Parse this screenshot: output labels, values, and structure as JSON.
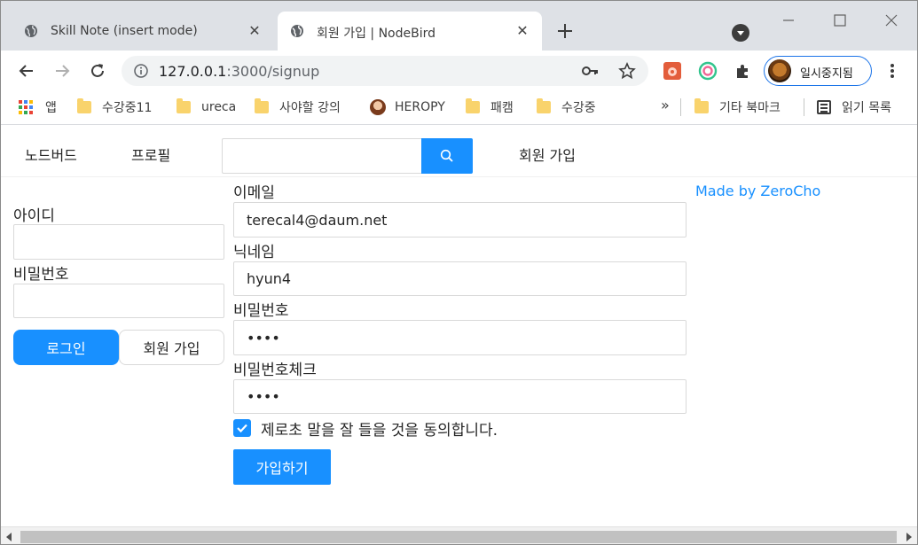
{
  "browser": {
    "tabs": [
      {
        "title": "Skill Note (insert mode)",
        "active": false
      },
      {
        "title": "회원 가입 | NodeBird",
        "active": true
      }
    ],
    "url_host": "127.0.0.1",
    "url_path": ":3000/signup",
    "profile_label": "일시중지됨",
    "accent_color": "#1a73e8"
  },
  "bookmarks": {
    "apps_label": "앱",
    "items": [
      "수강중11",
      "ureca",
      "사야할 강의",
      "HEROPY",
      "패캠",
      "수강중"
    ],
    "more_chevron": "»",
    "other_label": "기타 북마크",
    "reading_list_label": "읽기 목록"
  },
  "site": {
    "menu": {
      "home": "노드버드",
      "profile": "프로필",
      "signup": "회원 가입"
    },
    "login": {
      "id_label": "아이디",
      "password_label": "비밀번호",
      "login_button": "로그인",
      "signup_button": "회원 가입"
    },
    "signup_form": {
      "email_label": "이메일",
      "email_value": "terecal4@daum.net",
      "nickname_label": "닉네임",
      "nickname_value": "hyun4",
      "password_label": "비밀번호",
      "password_value": "••••",
      "password_check_label": "비밀번호체크",
      "password_check_value": "••••",
      "terms_label": "제로초 말을 잘 들을 것을 동의합니다.",
      "terms_checked": true,
      "submit_button": "가입하기"
    },
    "made_by": "Made by ZeroCho",
    "primary_color": "#1890ff"
  }
}
